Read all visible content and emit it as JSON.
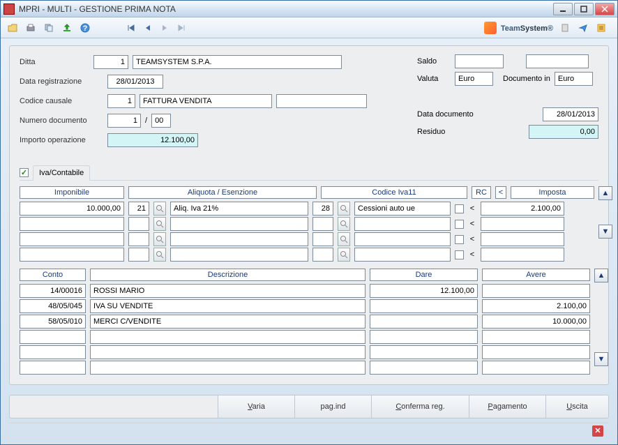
{
  "window": {
    "title": "MPRI  - MULTI -  GESTIONE PRIMA NOTA"
  },
  "brand": {
    "name_a": "Team",
    "name_b": "System",
    "reg": "®"
  },
  "header": {
    "ditta_label": "Ditta",
    "ditta_num": "1",
    "ditta_name": "TEAMSYSTEM S.P.A.",
    "data_reg_label": "Data registrazione",
    "data_reg": "28/01/2013",
    "cod_caus_label": "Codice causale",
    "cod_caus_num": "1",
    "cod_caus_desc": "FATTURA VENDITA",
    "num_doc_label": "Numero documento",
    "num_doc_a": "1",
    "num_doc_sep": "/",
    "num_doc_b": "00",
    "imp_op_label": "Importo operazione",
    "imp_op": "12.100,00",
    "saldo_label": "Saldo",
    "saldo": "",
    "valuta_label": "Valuta",
    "valuta": "Euro",
    "doc_in_label": "Documento in",
    "doc_in": "Euro",
    "data_doc_label": "Data documento",
    "data_doc": "28/01/2013",
    "residuo_label": "Residuo",
    "residuo": "0,00"
  },
  "tab": {
    "label": "Iva/Contabile"
  },
  "iva_headers": {
    "imponibile": "Imponibile",
    "aliq": "Aliquota / Esenzione",
    "iva11": "Codice Iva11",
    "rc": "RC",
    "lt": "<",
    "imposta": "Imposta"
  },
  "iva_rows": [
    {
      "imponibile": "10.000,00",
      "aliq_code": "21",
      "aliq_desc": "Aliq. Iva 21%",
      "iva11_code": "28",
      "iva11_desc": "Cessioni auto ue",
      "imposta": "2.100,00"
    },
    {
      "imponibile": "",
      "aliq_code": "",
      "aliq_desc": "",
      "iva11_code": "",
      "iva11_desc": "",
      "imposta": ""
    },
    {
      "imponibile": "",
      "aliq_code": "",
      "aliq_desc": "",
      "iva11_code": "",
      "iva11_desc": "",
      "imposta": ""
    },
    {
      "imponibile": "",
      "aliq_code": "",
      "aliq_desc": "",
      "iva11_code": "",
      "iva11_desc": "",
      "imposta": ""
    }
  ],
  "conto_headers": {
    "conto": "Conto",
    "descr": "Descrizione",
    "dare": "Dare",
    "avere": "Avere"
  },
  "conto_rows": [
    {
      "conto": "14/00016",
      "descr": "ROSSI MARIO",
      "dare": "12.100,00",
      "avere": ""
    },
    {
      "conto": "48/05/045",
      "descr": "IVA SU VENDITE",
      "dare": "",
      "avere": "2.100,00"
    },
    {
      "conto": "58/05/010",
      "descr": "MERCI C/VENDITE",
      "dare": "",
      "avere": "10.000,00"
    },
    {
      "conto": "",
      "descr": "",
      "dare": "",
      "avere": ""
    },
    {
      "conto": "",
      "descr": "",
      "dare": "",
      "avere": ""
    },
    {
      "conto": "",
      "descr": "",
      "dare": "",
      "avere": ""
    }
  ],
  "footer": {
    "varia": "Varia",
    "varia_u": "V",
    "pagind": "pag.ind",
    "conferma": "Conferma reg.",
    "conferma_u": "C",
    "pagamento": "Pagamento",
    "pagamento_u": "P",
    "uscita": "Uscita",
    "uscita_u": "U"
  }
}
